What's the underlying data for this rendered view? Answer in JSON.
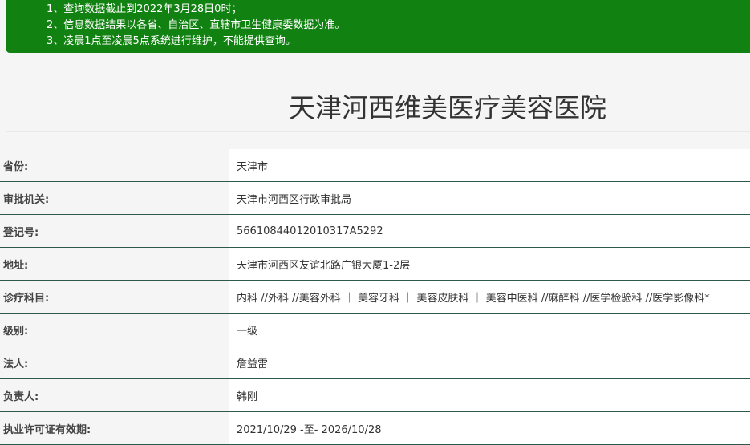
{
  "notice": {
    "lines": [
      "1、查询数据截止到2022年3月28日0时；",
      "2、信息数据结果以各省、自治区、直辖市卫生健康委数据为准。",
      "3、凌晨1点至凌晨5点系统进行维护，不能提供查询。"
    ],
    "bg_color": "#118211"
  },
  "title": "天津河西维美医疗美容医院",
  "rows": [
    {
      "label": "省份:",
      "value": "天津市"
    },
    {
      "label": "审批机关:",
      "value": "天津市河西区行政审批局"
    },
    {
      "label": "登记号:",
      "value": "56610844012010317A5292"
    },
    {
      "label": "地址:",
      "value": "天津市河西区友谊北路广银大厦1-2层"
    },
    {
      "label": "诊疗科目:",
      "value": "内科 //外科 //美容外科 ｜ 美容牙科 ｜ 美容皮肤科 ｜ 美容中医科 //麻醉科 //医学检验科 //医学影像科*"
    },
    {
      "label": "级别:",
      "value": "一级"
    },
    {
      "label": "法人:",
      "value": "詹益雷"
    },
    {
      "label": "负责人:",
      "value": "韩刚"
    },
    {
      "label": "执业许可证有效期:",
      "value": "2021/10/29 -至- 2026/10/28"
    }
  ]
}
